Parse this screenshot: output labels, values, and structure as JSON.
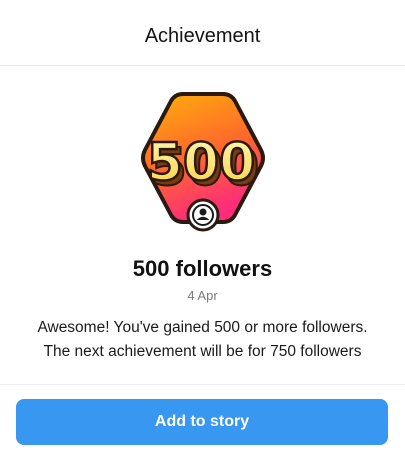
{
  "header": {
    "title": "Achievement"
  },
  "achievement": {
    "badge_number": "500",
    "badge_icon": "user-icon",
    "title": "500 followers",
    "date": "4 Apr",
    "description_line1": "Awesome! You've gained 500 or more followers.",
    "description_line2": "The next achievement will be for 750 followers"
  },
  "actions": {
    "add_to_story_label": "Add to story"
  },
  "colors": {
    "accent": "#3897f0",
    "badge_gradient_top": "#ffb10a",
    "badge_gradient_bottom": "#ff2d7a",
    "badge_number_fill": "#ffe98a",
    "badge_outline": "#2b1a10"
  }
}
